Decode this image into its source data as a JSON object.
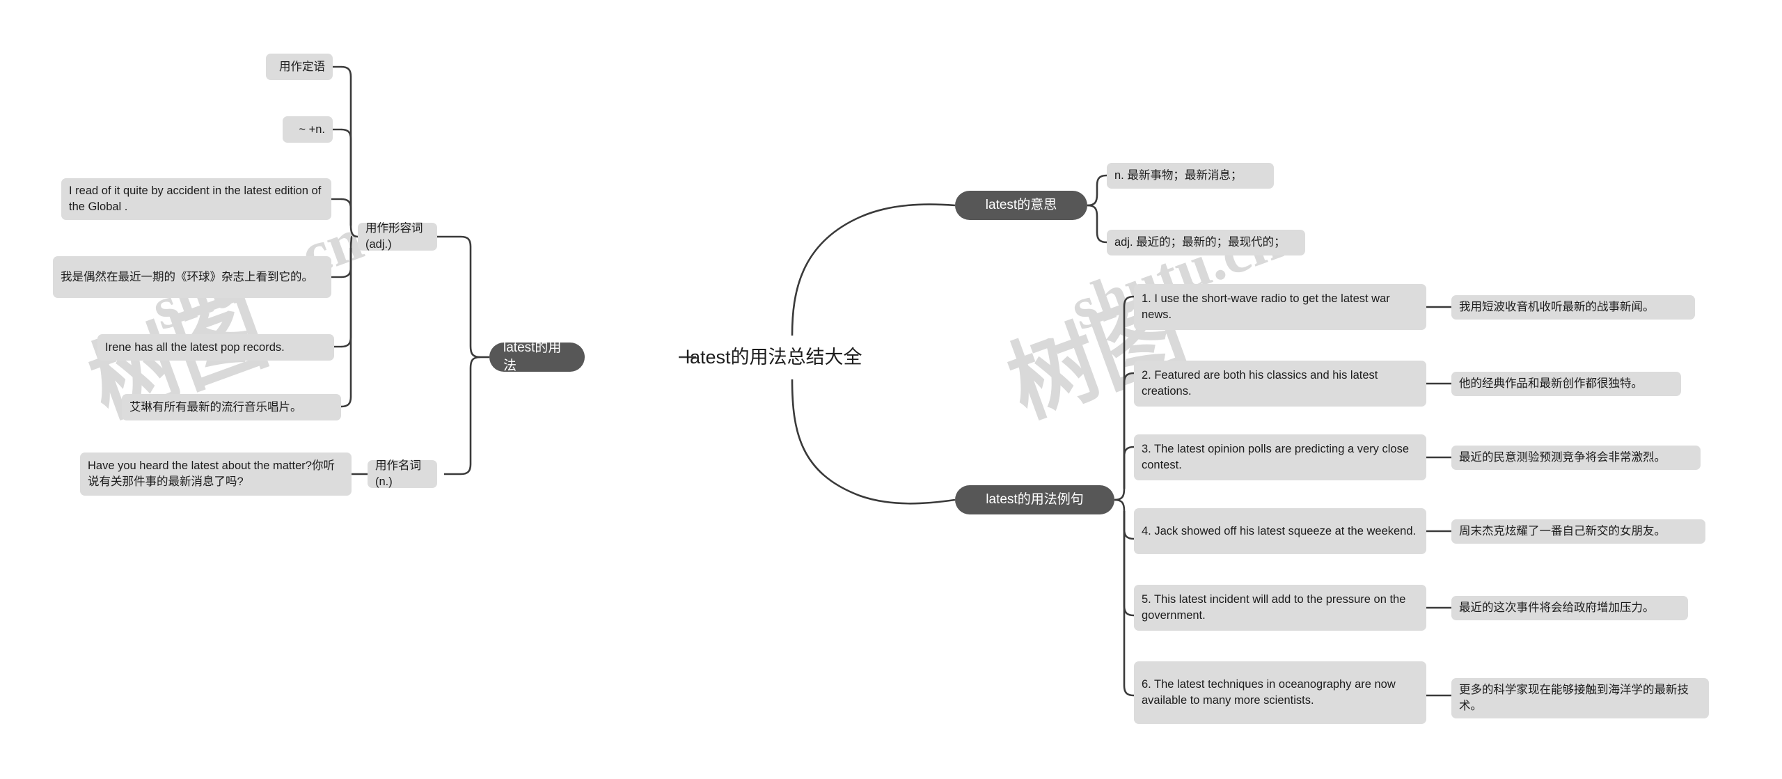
{
  "meta": {
    "background": "#ffffff",
    "node_dark_color": "#575757",
    "node_light_color": "#dcdcdc",
    "connector_color": "#3a3a3a",
    "watermark_color": "#d9d9d9"
  },
  "watermarks": [
    {
      "text": "树图 shutu.cn"
    },
    {
      "text": "树图 shutu.cn"
    }
  ],
  "watermark_parts": {
    "latin_1": "shutu.cn",
    "latin_2": "shutu.cn",
    "cjk_1": "树图",
    "cjk_2": "树图"
  },
  "root": {
    "title": "latest的用法总结大全"
  },
  "branches": {
    "usage": {
      "label": "latest的用法",
      "children": [
        {
          "label": "用作形容词(adj.)",
          "items": [
            {
              "label": "用作定语"
            },
            {
              "label": "~ +n."
            },
            {
              "label": "I read of it quite by accident in the latest edition of the Global ."
            },
            {
              "label": "我是偶然在最近一期的《环球》杂志上看到它的。"
            },
            {
              "label": "Irene has all the latest pop records."
            },
            {
              "label": "艾琳有所有最新的流行音乐唱片。"
            }
          ]
        },
        {
          "label": "用作名词(n.)",
          "items": [
            {
              "label": "Have you heard the latest about the matter?你听说有关那件事的最新消息了吗?"
            }
          ]
        }
      ]
    },
    "meaning": {
      "label": "latest的意思",
      "items": [
        {
          "label": "n. 最新事物；最新消息；"
        },
        {
          "label": "adj. 最近的；最新的；最现代的；"
        }
      ]
    },
    "examples": {
      "label": "latest的用法例句",
      "items": [
        {
          "en": "1. I use the short-wave radio to get the latest war news.",
          "zh": "我用短波收音机收听最新的战事新闻。"
        },
        {
          "en": "2. Featured are both his classics and his latest creations.",
          "zh": "他的经典作品和最新创作都很独特。"
        },
        {
          "en": "3. The latest opinion polls are predicting a very close contest.",
          "zh": "最近的民意测验预测竞争将会非常激烈。"
        },
        {
          "en": "4. Jack showed off his latest squeeze at the weekend.",
          "zh": "周末杰克炫耀了一番自己新交的女朋友。"
        },
        {
          "en": "5. This latest incident will add to the pressure on the government.",
          "zh": "最近的这次事件将会给政府增加压力。"
        },
        {
          "en": "6. The latest techniques in oceanography are now available to many more scientists.",
          "zh": "更多的科学家现在能够接触到海洋学的最新技术。"
        }
      ]
    }
  }
}
